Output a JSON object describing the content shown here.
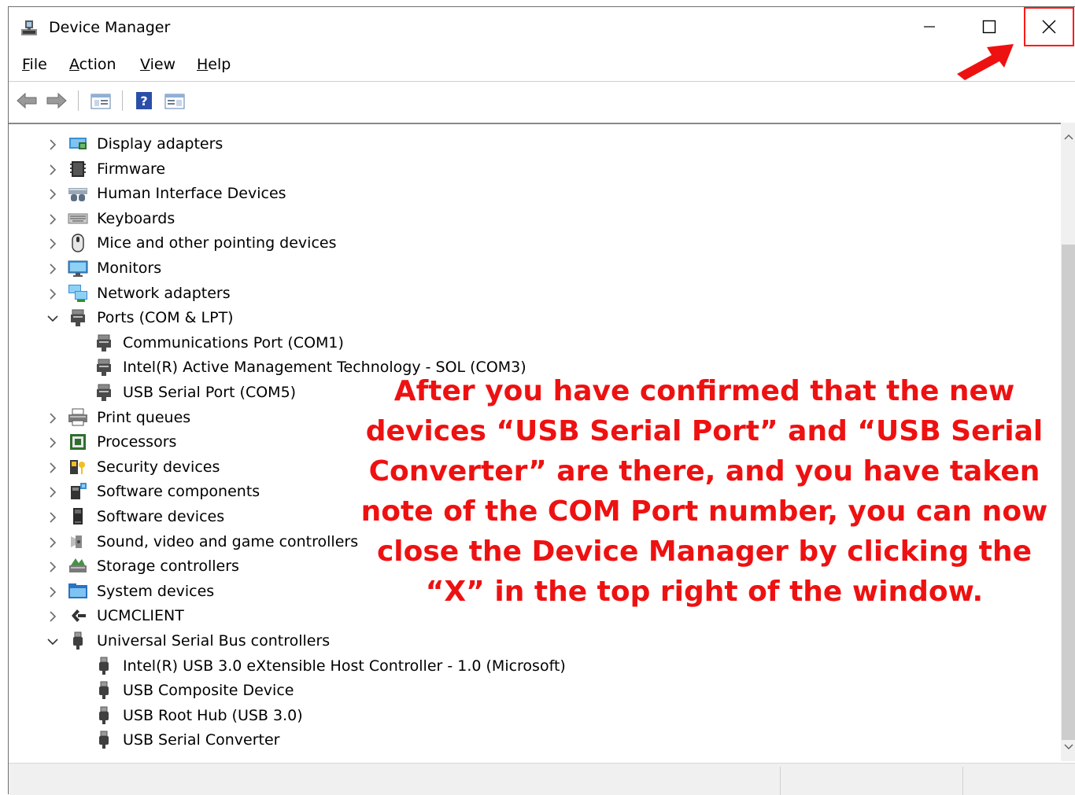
{
  "window": {
    "title": "Device Manager"
  },
  "menu": [
    {
      "label": "File",
      "key": "F",
      "rest": "ile"
    },
    {
      "label": "Action",
      "key": "A",
      "rest": "ction"
    },
    {
      "label": "View",
      "key": "V",
      "rest": "iew"
    },
    {
      "label": "Help",
      "key": "H",
      "rest": "elp"
    }
  ],
  "toolbar": {
    "back_icon": "back-arrow-icon",
    "forward_icon": "forward-arrow-icon",
    "properties_icon": "properties-icon",
    "help_icon": "help-icon",
    "update_icon": "update-driver-icon"
  },
  "tree": [
    {
      "label": "Display adapters",
      "level": 0,
      "state": "collapsed",
      "icon": "display-adapter-icon"
    },
    {
      "label": "Firmware",
      "level": 0,
      "state": "collapsed",
      "icon": "firmware-icon"
    },
    {
      "label": "Human Interface Devices",
      "level": 0,
      "state": "collapsed",
      "icon": "hid-icon"
    },
    {
      "label": "Keyboards",
      "level": 0,
      "state": "collapsed",
      "icon": "keyboard-icon"
    },
    {
      "label": "Mice and other pointing devices",
      "level": 0,
      "state": "collapsed",
      "icon": "mouse-icon"
    },
    {
      "label": "Monitors",
      "level": 0,
      "state": "collapsed",
      "icon": "monitor-icon"
    },
    {
      "label": "Network adapters",
      "level": 0,
      "state": "collapsed",
      "icon": "network-icon"
    },
    {
      "label": "Ports (COM & LPT)",
      "level": 0,
      "state": "expanded",
      "icon": "port-icon"
    },
    {
      "label": "Communications Port (COM1)",
      "level": 1,
      "state": "leaf",
      "icon": "port-icon"
    },
    {
      "label": "Intel(R) Active Management Technology - SOL (COM3)",
      "level": 1,
      "state": "leaf",
      "icon": "port-icon"
    },
    {
      "label": "USB Serial Port (COM5)",
      "level": 1,
      "state": "leaf",
      "icon": "port-icon"
    },
    {
      "label": "Print queues",
      "level": 0,
      "state": "collapsed",
      "icon": "printer-icon"
    },
    {
      "label": "Processors",
      "level": 0,
      "state": "collapsed",
      "icon": "processor-icon"
    },
    {
      "label": "Security devices",
      "level": 0,
      "state": "collapsed",
      "icon": "security-icon"
    },
    {
      "label": "Software components",
      "level": 0,
      "state": "collapsed",
      "icon": "software-component-icon"
    },
    {
      "label": "Software devices",
      "level": 0,
      "state": "collapsed",
      "icon": "software-device-icon"
    },
    {
      "label": "Sound, video and game controllers",
      "level": 0,
      "state": "collapsed",
      "icon": "speaker-icon"
    },
    {
      "label": "Storage controllers",
      "level": 0,
      "state": "collapsed",
      "icon": "storage-icon"
    },
    {
      "label": "System devices",
      "level": 0,
      "state": "collapsed",
      "icon": "system-folder-icon"
    },
    {
      "label": "UCMCLIENT",
      "level": 0,
      "state": "collapsed",
      "icon": "ucm-icon"
    },
    {
      "label": "Universal Serial Bus controllers",
      "level": 0,
      "state": "expanded",
      "icon": "usb-icon"
    },
    {
      "label": "Intel(R) USB 3.0 eXtensible Host Controller - 1.0 (Microsoft)",
      "level": 1,
      "state": "leaf",
      "icon": "usb-icon"
    },
    {
      "label": "USB Composite Device",
      "level": 1,
      "state": "leaf",
      "icon": "usb-icon"
    },
    {
      "label": "USB Root Hub (USB 3.0)",
      "level": 1,
      "state": "leaf",
      "icon": "usb-icon"
    },
    {
      "label": "USB Serial Converter",
      "level": 1,
      "state": "leaf",
      "icon": "usb-icon"
    }
  ],
  "annotation": {
    "text": "After you have confirmed that the new devices “USB Serial Port” and “USB Serial Converter” are there, and you have taken note of the COM Port number, you can now close the Device Manager by clicking the “X” in the top right of the window.",
    "color": "#ee1111"
  },
  "colors": {
    "highlight": "#ff1a1a",
    "chrome": "#f0f0f0"
  }
}
